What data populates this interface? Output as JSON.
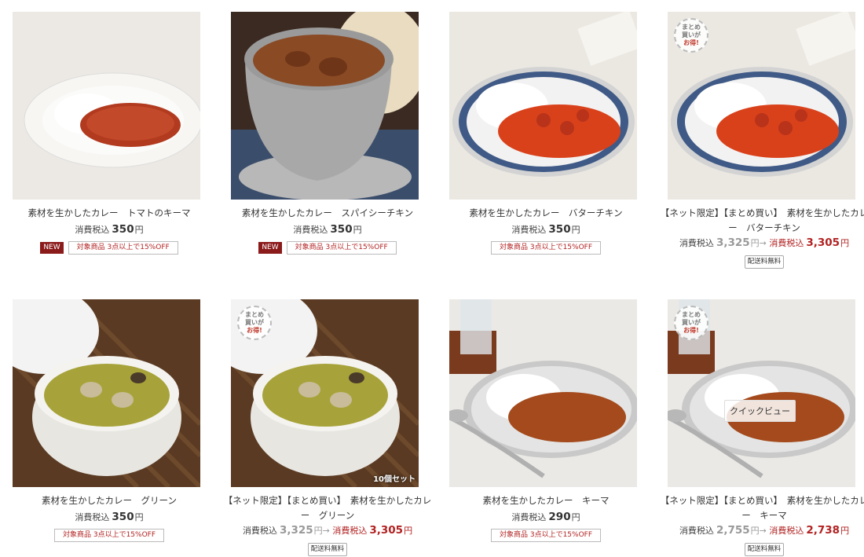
{
  "products": [
    {
      "name": "素材を生かしたカレー　トマトのキーマ",
      "price_label": "消費税込",
      "price": "350",
      "yen": "円",
      "badge_new": "NEW",
      "badge_offer": "対象商品 3点以上で15%OFF",
      "thumb_icon": "keema-tomato-curry-image"
    },
    {
      "name": "素材を生かしたカレー　スパイシーチキン",
      "price_label": "消費税込",
      "price": "350",
      "yen": "円",
      "badge_new": "NEW",
      "badge_offer": "対象商品 3点以上で15%OFF",
      "thumb_icon": "spicy-chicken-curry-image"
    },
    {
      "name": "素材を生かしたカレー　バターチキン",
      "price_label": "消費税込",
      "price": "350",
      "yen": "円",
      "badge_offer": "対象商品 3点以上で15%OFF",
      "thumb_icon": "butter-chicken-curry-image"
    },
    {
      "name": "【ネット限定】【まとめ買い】　素材を生かしたカレー　バターチキン",
      "old_label": "消費税込",
      "old_price": "3,325",
      "old_yen": "円→",
      "price_label": "消費税込",
      "price": "3,305",
      "yen": "円",
      "badge_ship": "配送料無料",
      "stamp": [
        "まとめ",
        "買いが",
        "お得!"
      ],
      "thumb_icon": "butter-chicken-curry-image"
    },
    {
      "name": "素材を生かしたカレー　グリーン",
      "price_label": "消費税込",
      "price": "350",
      "yen": "円",
      "badge_offer": "対象商品 3点以上で15%OFF",
      "thumb_icon": "green-curry-image"
    },
    {
      "name": "【ネット限定】【まとめ買い】　素材を生かしたカレー　グリーン",
      "old_label": "消費税込",
      "old_price": "3,325",
      "old_yen": "円→",
      "price_label": "消費税込",
      "price": "3,305",
      "yen": "円",
      "badge_ship": "配送料無料",
      "stamp": [
        "まとめ",
        "買いが",
        "お得!"
      ],
      "set_label": "10個セット",
      "thumb_icon": "green-curry-image"
    },
    {
      "name": "素材を生かしたカレー　キーマ",
      "price_label": "消費税込",
      "price": "290",
      "yen": "円",
      "badge_offer": "対象商品 3点以上で15%OFF",
      "thumb_icon": "keema-curry-image"
    },
    {
      "name": "【ネット限定】【まとめ買い】　素材を生かしたカレー　キーマ",
      "old_label": "消費税込",
      "old_price": "2,755",
      "old_yen": "円→",
      "price_label": "消費税込",
      "price": "2,738",
      "yen": "円",
      "badge_ship": "配送料無料",
      "stamp": [
        "まとめ",
        "買いが",
        "お得!"
      ],
      "quickview": "クイックビュー",
      "thumb_icon": "keema-curry-image"
    }
  ],
  "colors": {
    "accent": "#b22222",
    "new_badge": "#8b1a1a",
    "muted": "#999999"
  }
}
